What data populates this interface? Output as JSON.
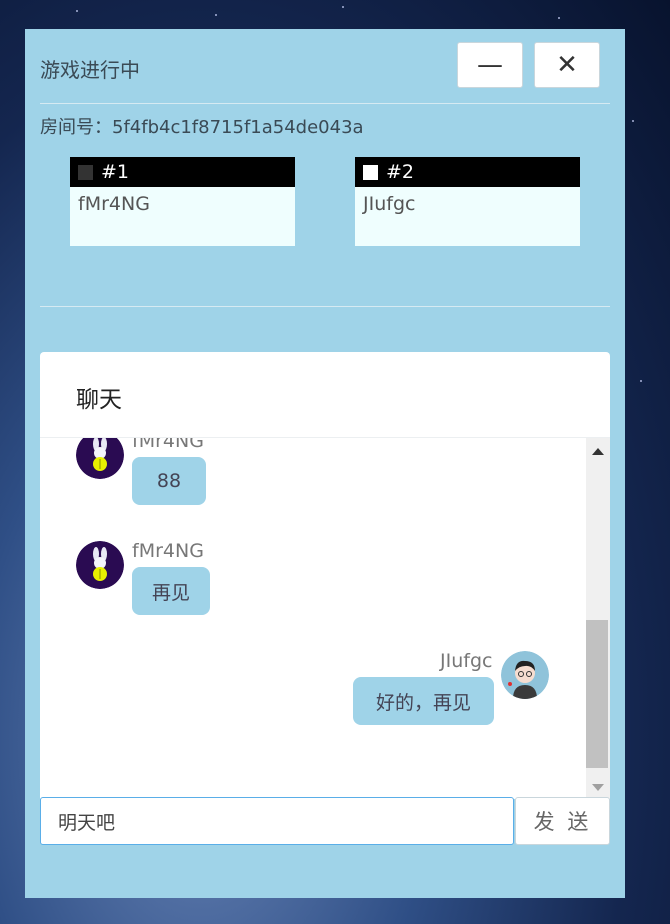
{
  "window": {
    "title": "游戏进行中",
    "minimize_icon": "minus-icon",
    "close_icon": "x-icon",
    "minimize_glyph": "—",
    "close_glyph": "✕"
  },
  "room": {
    "label": "房间号：5f4fb4c1f8715f1a54de043a"
  },
  "players": [
    {
      "number": "#1",
      "piece": "black-square-icon",
      "name": "fMr4NG"
    },
    {
      "number": "#2",
      "piece": "white-square-icon",
      "name": "JIufgc"
    }
  ],
  "chat": {
    "title": "聊天",
    "messages": [
      {
        "user": "fMr4NG",
        "text": "88",
        "side": "left"
      },
      {
        "user": "fMr4NG",
        "text": "再见",
        "side": "left"
      },
      {
        "user": "JIufgc",
        "text": "好的，再见",
        "side": "right"
      }
    ],
    "input_value": "明天吧",
    "send_label": "发 送"
  },
  "colors": {
    "panel": "#9fd3e8",
    "bubble": "#9fd3e8",
    "header_black": "#000000",
    "card": "#effefe"
  }
}
